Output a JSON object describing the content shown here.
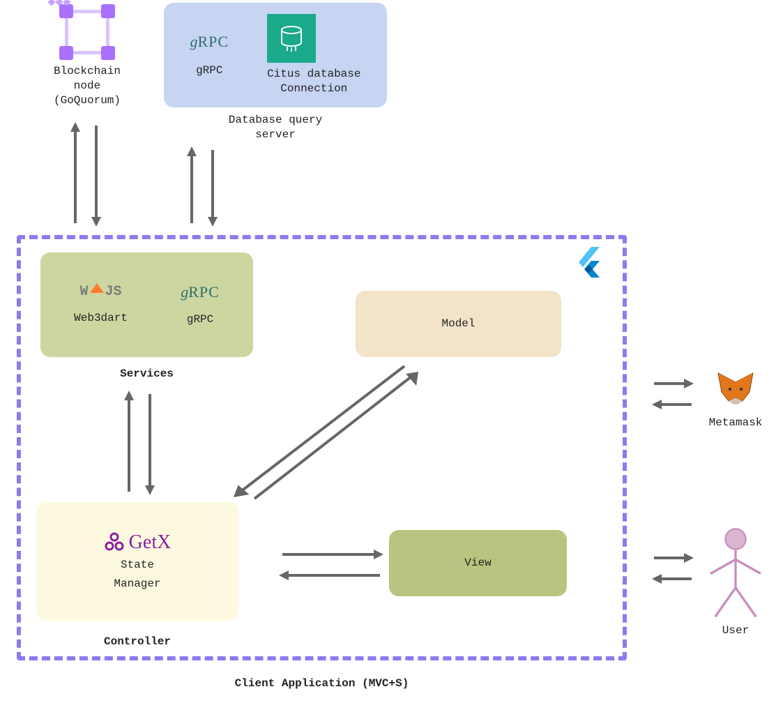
{
  "blockchain": {
    "line1": "Blockchain",
    "line2": "node",
    "line3": "(GoQuorum)"
  },
  "dbserver": {
    "grpc_label": "gRPC",
    "citus_line1": "Citus database",
    "citus_line2": "Connection",
    "caption_line1": "Database query",
    "caption_line2": "server"
  },
  "services": {
    "web3_label": "Web3dart",
    "grpc_label": "gRPC",
    "caption": "Services"
  },
  "model": {
    "label": "Model"
  },
  "view": {
    "label": "View"
  },
  "controller": {
    "getx": "GetX",
    "sub_line1": "State",
    "sub_line2": "Manager",
    "caption": "Controller"
  },
  "container_caption": "Client Application (MVC+S)",
  "metamask": {
    "label": "Metamask"
  },
  "user": {
    "label": "User"
  }
}
